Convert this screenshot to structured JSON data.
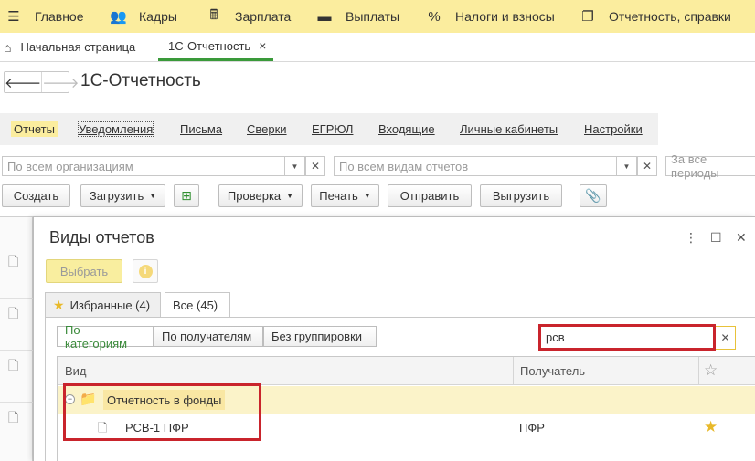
{
  "menubar": {
    "items": [
      {
        "icon": "hamburger-icon",
        "glyph": "☰",
        "label": "Главное"
      },
      {
        "icon": "people-icon",
        "glyph": "👥",
        "label": "Кадры"
      },
      {
        "icon": "calculator-icon",
        "glyph": "🖩",
        "label": "Зарплата"
      },
      {
        "icon": "wallet-icon",
        "glyph": "▬",
        "label": "Выплаты"
      },
      {
        "icon": "percent-icon",
        "glyph": "%",
        "label": "Налоги и взносы"
      },
      {
        "icon": "report-icon",
        "glyph": "❐",
        "label": "Отчетность, справки"
      }
    ]
  },
  "tabs": {
    "home_label": "Начальная страница",
    "active_label": "1С-Отчетность",
    "close_glyph": "×"
  },
  "page": {
    "title": "1С-Отчетность"
  },
  "sections": {
    "items": [
      "Отчеты",
      "Уведомления",
      "Письма",
      "Сверки",
      "ЕГРЮЛ",
      "Входящие",
      "Личные кабинеты",
      "Настройки"
    ],
    "active": "Отчеты"
  },
  "filters": {
    "organizations_placeholder": "По всем организациям",
    "report_types_placeholder": "По всем видам отчетов",
    "periods_placeholder": "За все периоды"
  },
  "toolbar": {
    "create": "Создать",
    "load": "Загрузить",
    "check": "Проверка",
    "print": "Печать",
    "send": "Отправить",
    "export": "Выгрузить"
  },
  "dialog": {
    "title": "Виды отчетов",
    "choose_button": "Выбрать",
    "tabs": [
      {
        "label": "Избранные (4)"
      },
      {
        "label": "Все (45)"
      }
    ],
    "grouping": [
      "По категориям",
      "По получателям",
      "Без группировки"
    ],
    "search_value": "рсв",
    "table": {
      "col_kind": "Вид",
      "col_recipient": "Получатель",
      "group_name": "Отчетность в фонды",
      "rows": [
        {
          "name": "РСВ-1 ПФР",
          "recipient": "ПФР",
          "favorite": true
        }
      ]
    }
  },
  "colors": {
    "menubar": "#fbed9e",
    "accent_green": "#3a9a3a",
    "highlight_red": "#c9242c",
    "star_gold": "#e8b92a"
  }
}
